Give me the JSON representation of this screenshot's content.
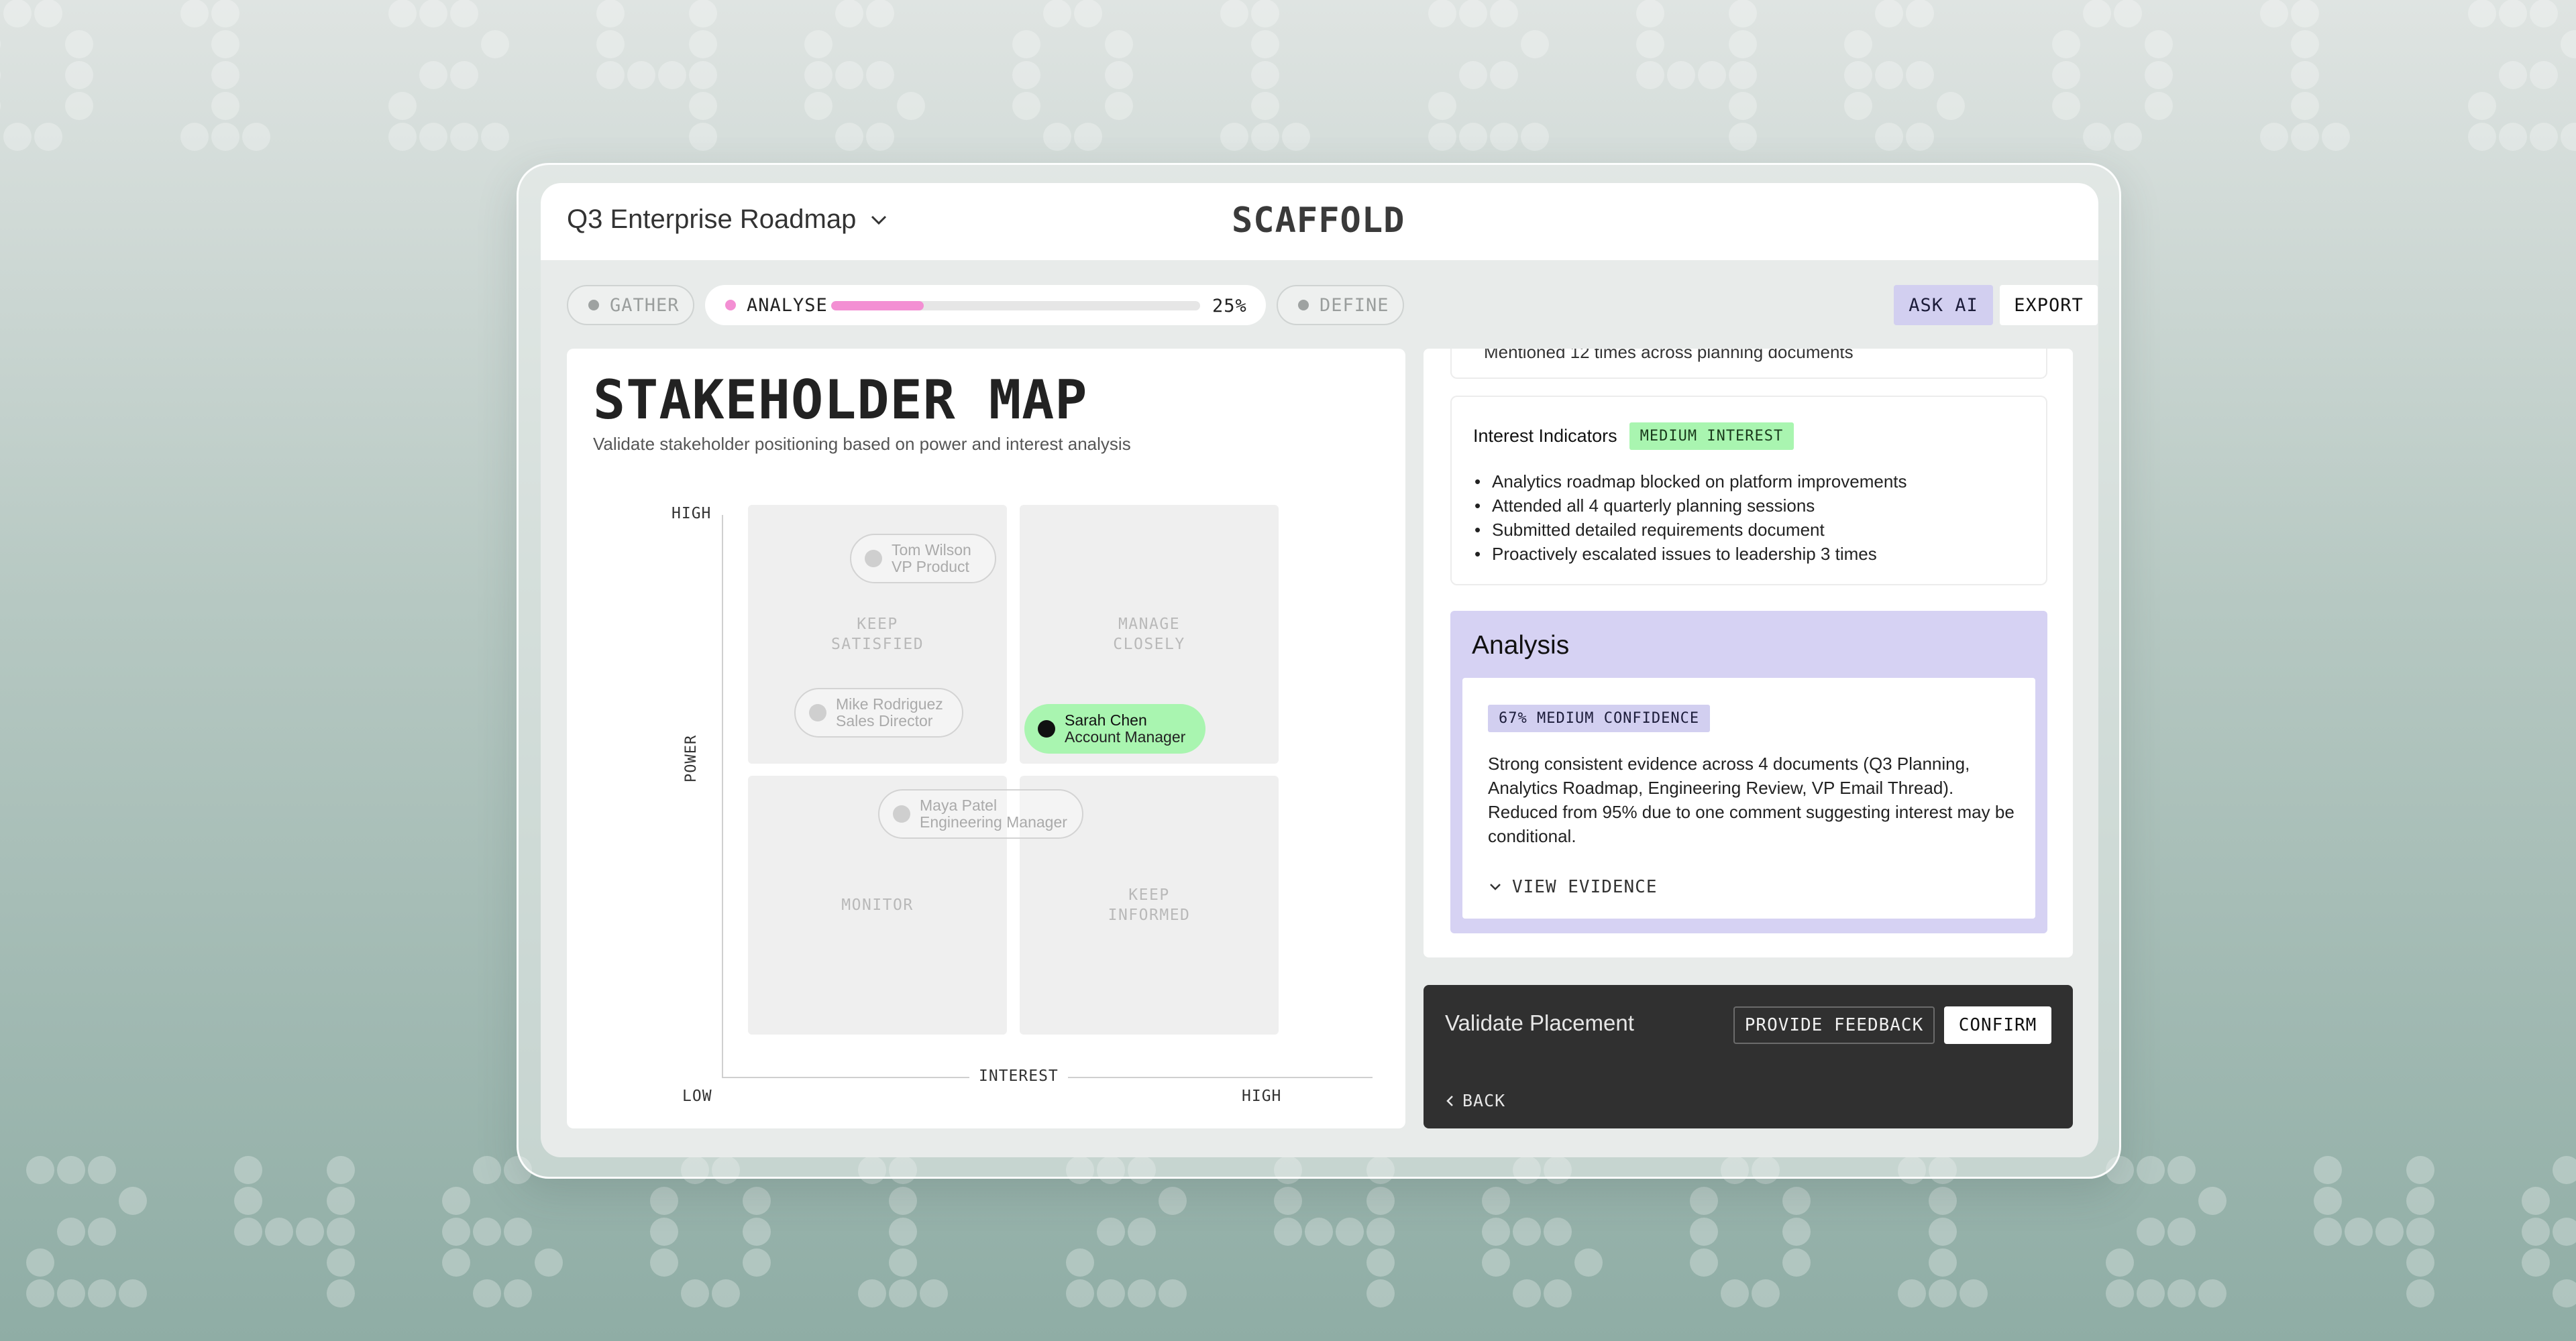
{
  "header": {
    "project_title": "Q3 Enterprise Roadmap",
    "logo": "SCAFFOLD"
  },
  "steps": [
    {
      "label": "GATHER",
      "state": "inactive"
    },
    {
      "label": "ANALYSE",
      "state": "active",
      "progress_percent": 25,
      "progress_label": "25%"
    },
    {
      "label": "DEFINE",
      "state": "inactive"
    }
  ],
  "actions": {
    "ask_ai": "ASK AI",
    "export": "EXPORT"
  },
  "stakeholder_map": {
    "title": "STAKEHOLDER MAP",
    "subtitle": "Validate stakeholder positioning based on power and interest analysis",
    "axis_y_label": "POWER",
    "axis_x_label": "INTEREST",
    "y_high": "HIGH",
    "x_low": "LOW",
    "x_high": "HIGH",
    "quadrants": {
      "keep_satisfied": "KEEP\nSATISFIED",
      "manage_closely": "MANAGE\nCLOSELY",
      "monitor": "MONITOR",
      "keep_informed": "KEEP\nINFORMED"
    },
    "stakeholders": [
      {
        "name": "Tom Wilson",
        "role": "VP Product"
      },
      {
        "name": "Mike Rodriguez",
        "role": "Sales Director"
      },
      {
        "name": "Sarah Chen",
        "role": "Account Manager",
        "selected": true
      },
      {
        "name": "Maya Patel",
        "role": "Engineering Manager"
      }
    ]
  },
  "details": {
    "prior_item": "Mentioned 12 times across planning documents",
    "interest": {
      "title": "Interest Indicators",
      "badge": "MEDIUM INTEREST",
      "items": [
        "Analytics roadmap blocked on platform improvements",
        "Attended all 4 quarterly planning sessions",
        "Submitted detailed requirements document",
        "Proactively escalated issues to leadership 3 times"
      ]
    },
    "analysis": {
      "title": "Analysis",
      "confidence_badge": "67% MEDIUM CONFIDENCE",
      "text": "Strong consistent evidence across 4 documents (Q3 Planning, Analytics  Roadmap, Engineering Review, VP Email Thread). Reduced from 95% due to  one comment suggesting interest may be conditional.",
      "view_evidence": "VIEW EVIDENCE"
    }
  },
  "validate": {
    "title": "Validate Placement",
    "provide_feedback": "PROVIDE FEEDBACK",
    "confirm": "CONFIRM",
    "back": "BACK"
  },
  "colors": {
    "accent_pink": "#f38fd3",
    "accent_green": "#a9f5b0",
    "accent_purple": "#d6d2f3",
    "dark_bar": "#303030"
  }
}
